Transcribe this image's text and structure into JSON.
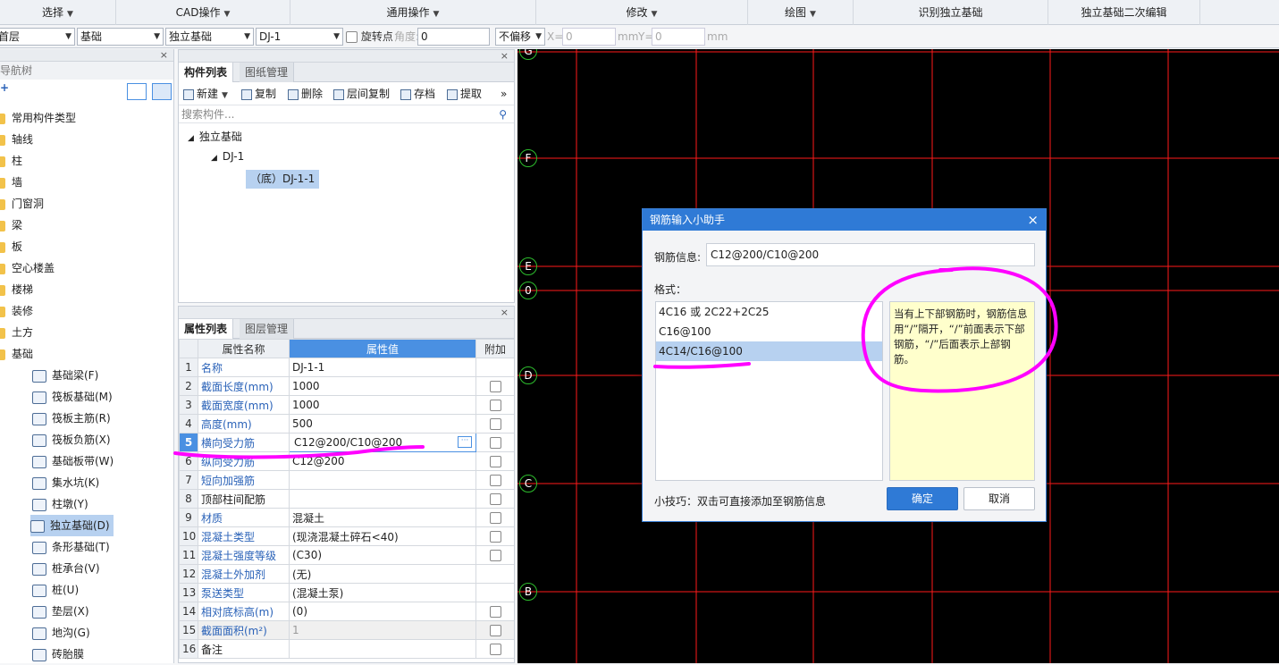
{
  "menubar": {
    "items": [
      "选择",
      "CAD操作",
      "通用操作",
      "修改",
      "绘图",
      "识别独立基础",
      "独立基础二次编辑"
    ]
  },
  "toolbar": {
    "floor": "首层",
    "type1": "基础",
    "type2": "独立基础",
    "component": "DJ-1",
    "rotate_label": "旋转点",
    "angle_label": "角度:",
    "angle_value": "0",
    "offset": "不偏移",
    "x_label": "X=",
    "x_value": "0",
    "mm1": "mm",
    "y_label": "Y=",
    "y_value": "0",
    "mm2": "mm"
  },
  "nav": {
    "title": "导航树",
    "add": "+",
    "items": [
      "常用构件类型",
      "轴线",
      "柱",
      "墙",
      "门窗洞",
      "梁",
      "板",
      "空心楼盖",
      "楼梯",
      "装修",
      "土方",
      "基础"
    ],
    "sub": [
      "基础梁(F)",
      "筏板基础(M)",
      "筏板主筋(R)",
      "筏板负筋(X)",
      "基础板带(W)",
      "集水坑(K)",
      "柱墩(Y)",
      "独立基础(D)",
      "条形基础(T)",
      "桩承台(V)",
      "桩(U)",
      "垫层(X)",
      "地沟(G)",
      "砖胎膜"
    ]
  },
  "comp": {
    "tab_active": "构件列表",
    "tab_other": "图纸管理",
    "tools": {
      "new": "新建",
      "copy": "复制",
      "delete": "删除",
      "floor_copy": "层间复制",
      "save": "存档",
      "extract": "提取",
      "more": "»"
    },
    "search_placeholder": "搜索构件...",
    "tree": {
      "root": "独立基础",
      "child": "DJ-1",
      "leaf": "（底）DJ-1-1"
    }
  },
  "props": {
    "tab_active": "属性列表",
    "tab_other": "图层管理",
    "headers": {
      "name": "属性名称",
      "value": "属性值",
      "extra": "附加"
    },
    "rows": [
      {
        "n": "1",
        "name": "名称",
        "value": "DJ-1-1",
        "blue": true,
        "cb": false
      },
      {
        "n": "2",
        "name": "截面长度(mm)",
        "value": "1000",
        "blue": true,
        "cb": true
      },
      {
        "n": "3",
        "name": "截面宽度(mm)",
        "value": "1000",
        "blue": true,
        "cb": true
      },
      {
        "n": "4",
        "name": "高度(mm)",
        "value": "500",
        "blue": true,
        "cb": true
      },
      {
        "n": "5",
        "name": "横向受力筋",
        "value": "C12@200/C10@200",
        "blue": true,
        "cb": true
      },
      {
        "n": "6",
        "name": "纵向受力筋",
        "value": "C12@200",
        "blue": true,
        "cb": true
      },
      {
        "n": "7",
        "name": "短向加强筋",
        "value": "",
        "blue": true,
        "cb": true
      },
      {
        "n": "8",
        "name": "顶部柱间配筋",
        "value": "",
        "blue": false,
        "cb": true
      },
      {
        "n": "9",
        "name": "材质",
        "value": "混凝土",
        "blue": true,
        "cb": true
      },
      {
        "n": "10",
        "name": "混凝土类型",
        "value": "(现浇混凝土碎石<40)",
        "blue": true,
        "cb": true
      },
      {
        "n": "11",
        "name": "混凝土强度等级",
        "value": "(C30)",
        "blue": true,
        "cb": true
      },
      {
        "n": "12",
        "name": "混凝土外加剂",
        "value": "(无)",
        "blue": true,
        "cb": false
      },
      {
        "n": "13",
        "name": "泵送类型",
        "value": "(混凝土泵)",
        "blue": true,
        "cb": false
      },
      {
        "n": "14",
        "name": "相对底标高(m)",
        "value": "(0)",
        "blue": true,
        "cb": true
      },
      {
        "n": "15",
        "name": "截面面积(m²)",
        "value": "1",
        "blue": true,
        "cb": true
      },
      {
        "n": "16",
        "name": "备注",
        "value": "",
        "blue": false,
        "cb": true
      }
    ]
  },
  "cad": {
    "axes": [
      "G",
      "F",
      "E",
      "0",
      "D",
      "C",
      "B"
    ]
  },
  "dialog": {
    "title": "钢筋输入小助手",
    "close": "×",
    "info_label": "钢筋信息:",
    "info_value": "C12@200/C10@200",
    "format_label": "格式：",
    "formats": [
      "4C16 或 2C22+2C25",
      "C16@100",
      "4C14/C16@100"
    ],
    "note": "当有上下部钢筋时，钢筋信息用“/”隔开，“/”前面表示下部钢筋，“/”后面表示上部钢筋。",
    "tip": "小技巧：双击可直接添加至钢筋信息",
    "ok": "确定",
    "cancel": "取消"
  },
  "colors": {
    "accent": "#2f7ad6",
    "annotation": "#ff00ff",
    "grid": "#ff0000",
    "axis_circle": "#2dbd2d"
  }
}
